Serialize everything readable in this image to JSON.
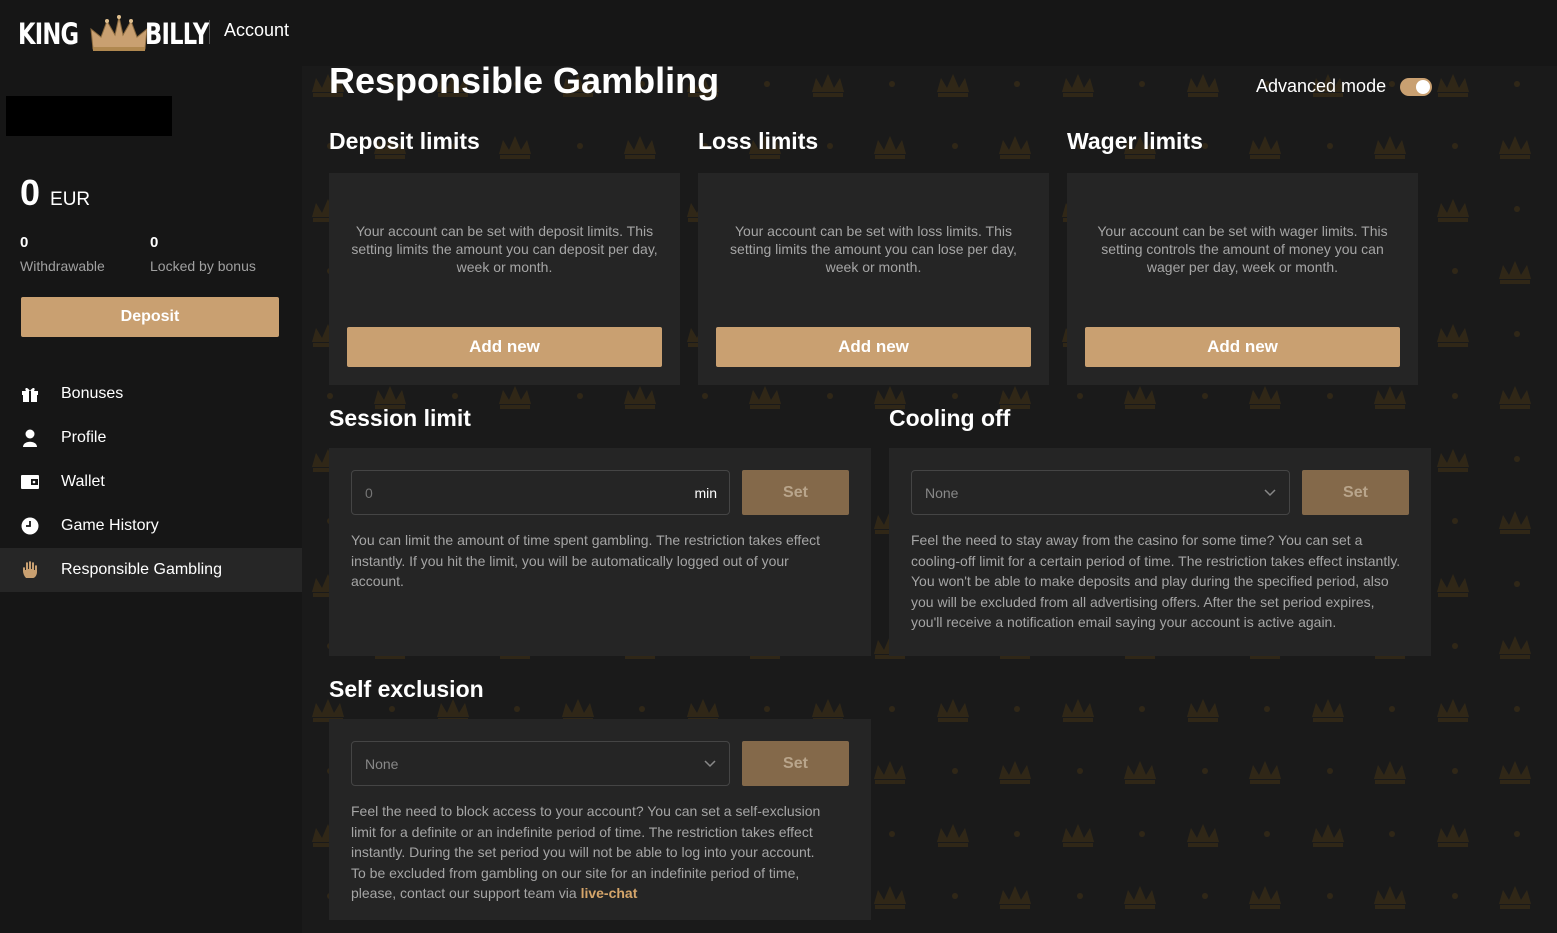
{
  "header": {
    "logo_left": "KING",
    "logo_right": "BILLY",
    "section": "Account"
  },
  "sidebar": {
    "balance": {
      "amount": "0",
      "currency": "EUR"
    },
    "withdrawable": {
      "value": "0",
      "label": "Withdrawable"
    },
    "locked": {
      "value": "0",
      "label": "Locked by bonus"
    },
    "deposit_label": "Deposit",
    "items": [
      {
        "label": "Bonuses",
        "icon": "gift-icon"
      },
      {
        "label": "Profile",
        "icon": "user-icon"
      },
      {
        "label": "Wallet",
        "icon": "wallet-icon"
      },
      {
        "label": "Game History",
        "icon": "clock-icon"
      },
      {
        "label": "Responsible Gambling",
        "icon": "hand-icon",
        "active": true
      }
    ]
  },
  "main": {
    "title": "Responsible Gambling",
    "advanced_mode": {
      "label": "Advanced mode",
      "enabled": true
    },
    "deposit_limits": {
      "title": "Deposit limits",
      "description": "Your account can be set with deposit limits. This setting limits the amount you can deposit per day, week or month.",
      "button": "Add new"
    },
    "loss_limits": {
      "title": "Loss limits",
      "description": "Your account can be set with loss limits. This setting limits the amount you can lose per day, week or month.",
      "button": "Add new"
    },
    "wager_limits": {
      "title": "Wager limits",
      "description": "Your account can be set with wager limits. This setting controls the amount of money you can wager per day, week or month.",
      "button": "Add new"
    },
    "session_limit": {
      "title": "Session limit",
      "placeholder": "0",
      "suffix": "min",
      "button": "Set",
      "description": "You can limit the amount of time spent gambling. The restriction takes effect instantly. If you hit the limit, you will be automatically logged out of your account."
    },
    "cooling_off": {
      "title": "Cooling off",
      "selected": "None",
      "button": "Set",
      "description": "Feel the need to stay away from the casino for some time? You can set a cooling-off limit for a certain period of time. The restriction takes effect instantly. You won't be able to make deposits and play during the specified period, also you will be excluded from all advertising offers. After the set period expires, you'll receive a notification email saying your account is active again."
    },
    "self_exclusion": {
      "title": "Self exclusion",
      "selected": "None",
      "button": "Set",
      "description": "Feel the need to block access to your account? You can set a self-exclusion limit for a definite or an indefinite period of time. The restriction takes effect instantly. During the set period you will not be able to log into your account.",
      "description2": "To be excluded from gambling on our site for an indefinite period of time, please, contact our support team via",
      "link": "live-chat"
    }
  },
  "colors": {
    "accent": "#c9a071",
    "accent_muted": "#84694a",
    "card": "#252525",
    "background": "#161616"
  }
}
